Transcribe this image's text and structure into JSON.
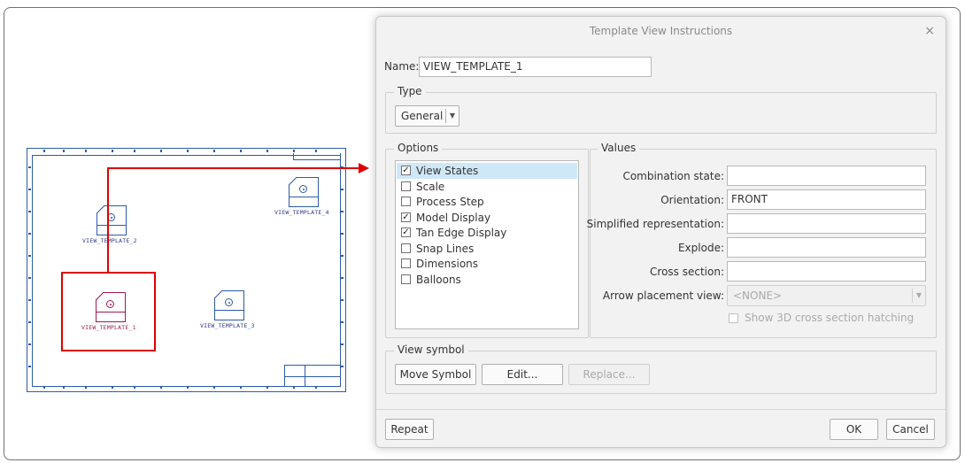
{
  "drawing": {
    "views": [
      {
        "name": "VIEW_TEMPLATE_2"
      },
      {
        "name": "VIEW_TEMPLATE_4"
      },
      {
        "name": "VIEW_TEMPLATE_1"
      },
      {
        "name": "VIEW_TEMPLATE_3"
      }
    ]
  },
  "dialog": {
    "title": "Template View Instructions",
    "close": "×",
    "name_label": "Name:",
    "name_value": "VIEW_TEMPLATE_1",
    "type_group": "Type",
    "type_value": "General",
    "options_group": "Options",
    "options": [
      {
        "label": "View States",
        "checked": true,
        "selected": true
      },
      {
        "label": "Scale",
        "checked": false
      },
      {
        "label": "Process Step",
        "checked": false
      },
      {
        "label": "Model Display",
        "checked": true
      },
      {
        "label": "Tan Edge Display",
        "checked": true
      },
      {
        "label": "Snap Lines",
        "checked": false
      },
      {
        "label": "Dimensions",
        "checked": false
      },
      {
        "label": "Balloons",
        "checked": false
      }
    ],
    "values_group": "Values",
    "values": {
      "combination_label": "Combination state:",
      "combination_value": "",
      "orientation_label": "Orientation:",
      "orientation_value": "FRONT",
      "simplified_label": "Simplified representation:",
      "simplified_value": "",
      "explode_label": "Explode:",
      "explode_value": "",
      "cross_label": "Cross section:",
      "cross_value": "",
      "arrow_label": "Arrow placement view:",
      "arrow_value": "<NONE>",
      "hatching_label": "Show 3D cross section hatching"
    },
    "symbol_group": "View symbol",
    "move_symbol": "Move Symbol",
    "edit": "Edit...",
    "replace": "Replace...",
    "repeat": "Repeat",
    "ok": "OK",
    "cancel": "Cancel"
  }
}
